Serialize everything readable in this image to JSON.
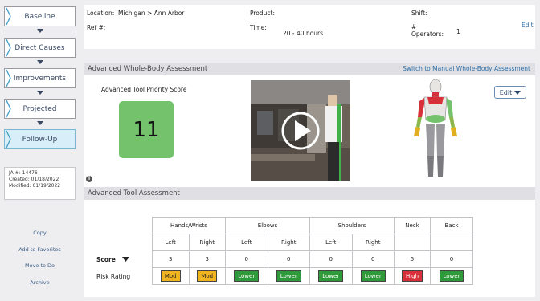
{
  "sidebar": {
    "steps": [
      {
        "label": "Baseline"
      },
      {
        "label": "Direct Causes"
      },
      {
        "label": "Improvements"
      },
      {
        "label": "Projected"
      },
      {
        "label": "Follow-Up"
      }
    ],
    "info": {
      "ja": "JA #: 14476",
      "created": "Created: 01/18/2022",
      "modified": "Modified: 01/19/2022"
    },
    "links": [
      "Copy",
      "Add to Favorites",
      "Move to Do",
      "Archive"
    ]
  },
  "header": {
    "location_label": "Location:",
    "location_value": "Michigan > Ann Arbor",
    "product_label": "Product:",
    "shift_label": "Shift:",
    "ref_label": "Ref #:",
    "time_label": "Time:",
    "time_value": "20 - 40 hours",
    "operators_hash": "#",
    "operators_label": "Operators:",
    "operators_value": "1",
    "edit": "Edit"
  },
  "assessment": {
    "title": "Advanced Whole-Body Assessment",
    "switch_link": "Switch to Manual Whole-Body Assessment",
    "score_label": "Advanced Tool Priority Score",
    "score_value": "11",
    "edit_button": "Edit"
  },
  "tool": {
    "title": "Advanced Tool Assessment",
    "groups": [
      "Hands/Wrists",
      "Elbows",
      "Shoulders",
      "Neck",
      "Back"
    ],
    "sides": [
      "Left",
      "Right",
      "Left",
      "Right",
      "Left",
      "Right"
    ],
    "score_label": "Score",
    "risk_label": "Risk Rating",
    "scores": [
      "3",
      "3",
      "0",
      "0",
      "0",
      "0",
      "5",
      "0"
    ],
    "ratings": [
      "Mod",
      "Mod",
      "Lower",
      "Lower",
      "Lower",
      "Lower",
      "High",
      "Lower"
    ]
  },
  "colors": {
    "score_green": "#74c36c",
    "mod": "#f0b420",
    "lower": "#2f9a3c",
    "high": "#d8303a",
    "active_step": "#d8eef8"
  }
}
